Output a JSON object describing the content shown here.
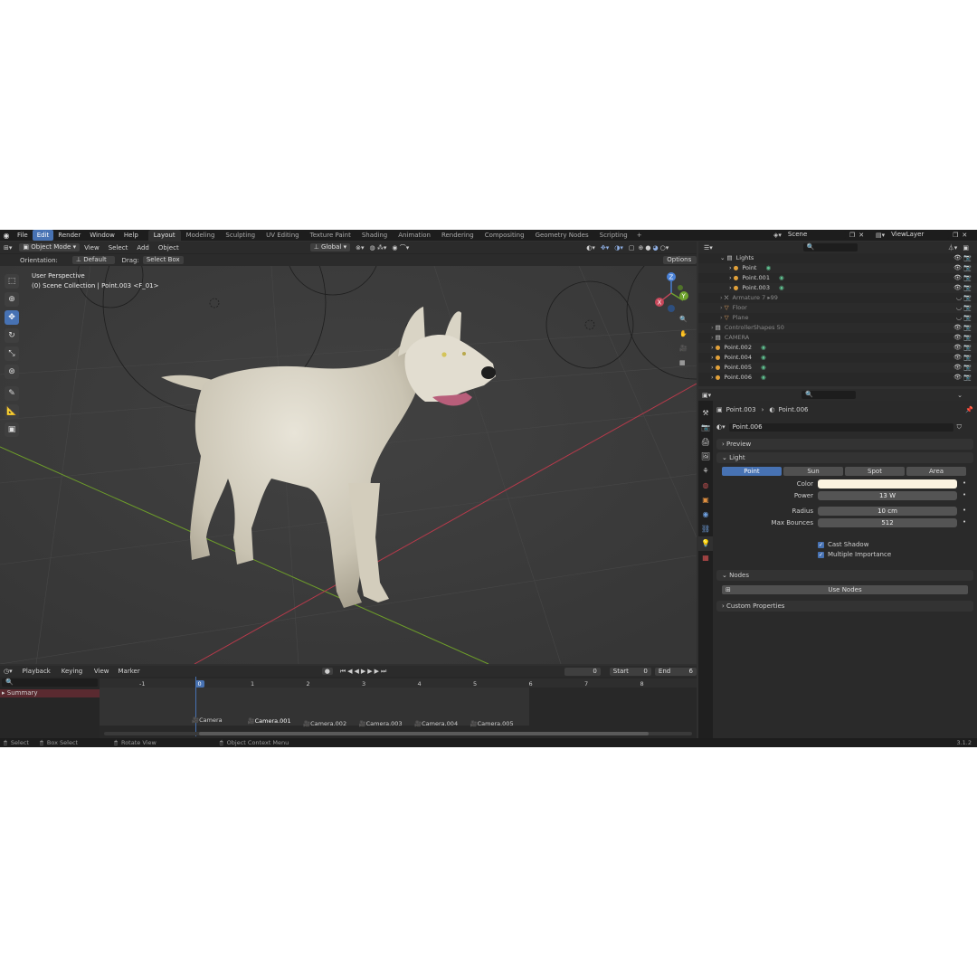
{
  "top_menu": [
    "File",
    "Edit",
    "Render",
    "Window",
    "Help"
  ],
  "active_menu_index": 1,
  "workspace_tabs": [
    "Layout",
    "Modeling",
    "Sculpting",
    "UV Editing",
    "Texture Paint",
    "Shading",
    "Animation",
    "Rendering",
    "Compositing",
    "Geometry Nodes",
    "Scripting"
  ],
  "add_workspace": "+",
  "scene": "Scene",
  "view_layer": "ViewLayer",
  "viewport": {
    "mode": "Object Mode",
    "menus": [
      "View",
      "Select",
      "Add",
      "Object"
    ],
    "orientation_menu": "Global",
    "orientation_label": "Orientation:",
    "orientation_value": "Default",
    "drag_label": "Drag:",
    "drag_value": "Select Box",
    "options": "Options",
    "overlay_title": "User Perspective",
    "overlay_subtitle": "(0) Scene Collection | Point.003 <F_01>",
    "gizmo_x": "X",
    "gizmo_y": "Y",
    "gizmo_z": "Z"
  },
  "outliner": {
    "rows": [
      {
        "label": "Lights",
        "indent": 2,
        "icon": "collection",
        "dim": false
      },
      {
        "label": "Point",
        "indent": 3,
        "icon": "light",
        "dim": false
      },
      {
        "label": "Point.001",
        "indent": 3,
        "icon": "light",
        "dim": false
      },
      {
        "label": "Point.003",
        "indent": 3,
        "icon": "light",
        "dim": false
      },
      {
        "label": "Armature",
        "indent": 2,
        "icon": "armature",
        "dim": true
      },
      {
        "label": "Floor",
        "indent": 2,
        "icon": "mesh",
        "dim": true
      },
      {
        "label": "Plane",
        "indent": 2,
        "icon": "mesh",
        "dim": true
      },
      {
        "label": "ControllerShapes",
        "indent": 1,
        "icon": "collection",
        "dim": true
      },
      {
        "label": "CAMERA",
        "indent": 1,
        "icon": "collection",
        "dim": true
      },
      {
        "label": "Point.002",
        "indent": 1,
        "icon": "light",
        "dim": false
      },
      {
        "label": "Point.004",
        "indent": 1,
        "icon": "light",
        "dim": false
      },
      {
        "label": "Point.005",
        "indent": 1,
        "icon": "light",
        "dim": false
      },
      {
        "label": "Point.006",
        "indent": 1,
        "icon": "light",
        "dim": false
      }
    ],
    "armature_count": "7 ▸99",
    "controller_count": "50"
  },
  "properties": {
    "breadcrumb_object": "Point.003",
    "breadcrumb_data": "Point.006",
    "datablock": "Point.006",
    "panel_preview": "Preview",
    "panel_light": "Light",
    "light_types": [
      "Point",
      "Sun",
      "Spot",
      "Area"
    ],
    "active_light_type": 0,
    "color_label": "Color",
    "color_value": "#fbf3e0",
    "power_label": "Power",
    "power_value": "13 W",
    "radius_label": "Radius",
    "radius_value": "10 cm",
    "bounces_label": "Max Bounces",
    "bounces_value": "512",
    "cast_shadow": "Cast Shadow",
    "multiple_importance": "Multiple Importance",
    "panel_nodes": "Nodes",
    "use_nodes": "Use Nodes",
    "panel_custom": "Custom Properties"
  },
  "timeline": {
    "menus": [
      "Playback",
      "Keying",
      "View",
      "Marker"
    ],
    "current_frame": "0",
    "start_label": "Start",
    "start_value": "0",
    "end_label": "End",
    "end_value": "6",
    "frame_numbers": [
      "-1",
      "0",
      "1",
      "2",
      "3",
      "4",
      "5",
      "6",
      "7",
      "8"
    ],
    "channel": "Summary",
    "markers": [
      "Camera",
      "Camera.001",
      "Camera.002",
      "Camera.003",
      "Camera.004",
      "Camera.005"
    ]
  },
  "statusbar": {
    "select": "Select",
    "box_select": "Box Select",
    "rotate_view": "Rotate View",
    "context_menu": "Object Context Menu",
    "version": "3.1.2"
  },
  "colors": {
    "accent": "#4772b3",
    "x_axis": "#b83a4b",
    "y_axis": "#6e9e2a",
    "light_icon": "#e2a13a"
  }
}
